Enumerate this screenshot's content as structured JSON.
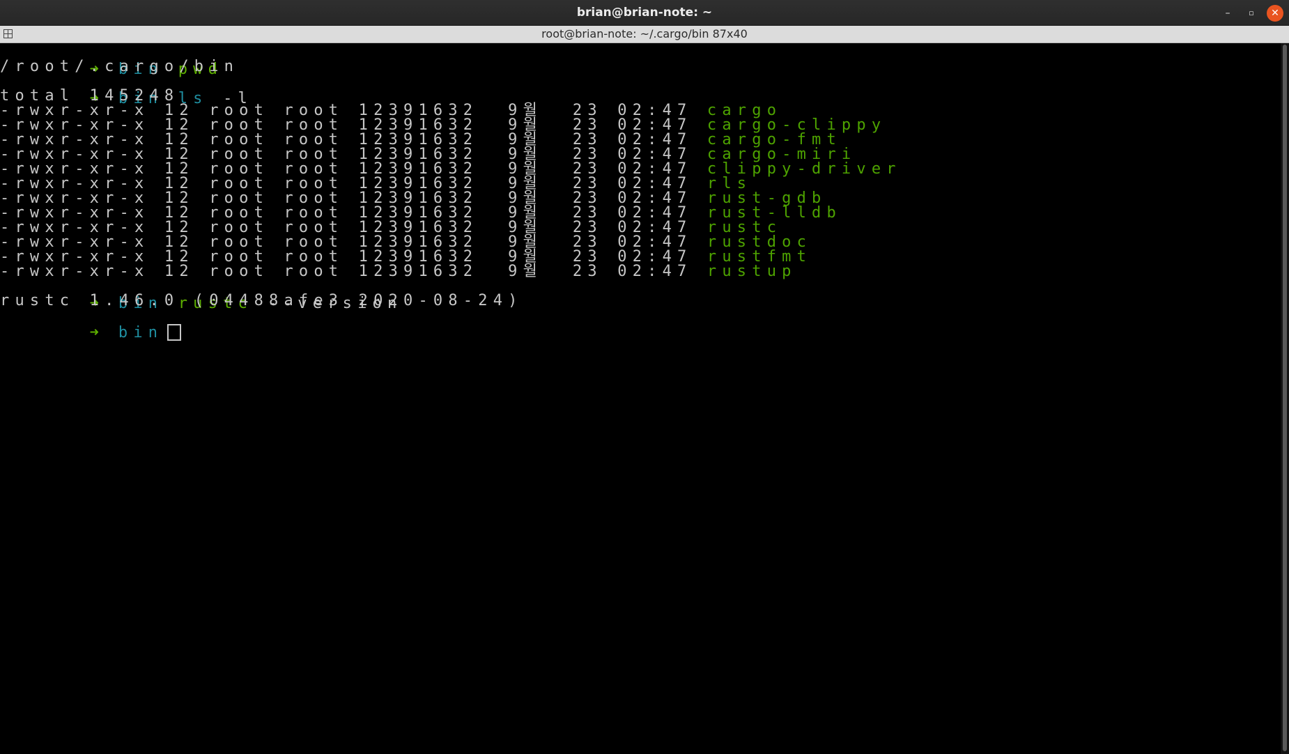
{
  "window": {
    "title": "brian@brian-note: ~",
    "tab_title": "root@brian-note: ~/.cargo/bin 87x40",
    "minimize_label": "–",
    "maximize_label": "▫",
    "close_label": "✕"
  },
  "colors": {
    "background": "#000000",
    "prompt_arrow": "#5eb000",
    "prompt_dir": "#1f8ea0",
    "executable": "#4ea300",
    "text": "#c7c7c7"
  },
  "terminal": {
    "prompt_arrow": "➜",
    "prompt_dir": "bin",
    "cmd1": {
      "command": "pwd",
      "args": ""
    },
    "out1": "/root/.cargo/bin",
    "cmd2": {
      "command": "ls",
      "args": "-l"
    },
    "total": "total 145248",
    "files": [
      {
        "perms": "-rwxr-xr-x 12 root root 12391632  9월  23 02:47 ",
        "name": "cargo"
      },
      {
        "perms": "-rwxr-xr-x 12 root root 12391632  9월  23 02:47 ",
        "name": "cargo-clippy"
      },
      {
        "perms": "-rwxr-xr-x 12 root root 12391632  9월  23 02:47 ",
        "name": "cargo-fmt"
      },
      {
        "perms": "-rwxr-xr-x 12 root root 12391632  9월  23 02:47 ",
        "name": "cargo-miri"
      },
      {
        "perms": "-rwxr-xr-x 12 root root 12391632  9월  23 02:47 ",
        "name": "clippy-driver"
      },
      {
        "perms": "-rwxr-xr-x 12 root root 12391632  9월  23 02:47 ",
        "name": "rls"
      },
      {
        "perms": "-rwxr-xr-x 12 root root 12391632  9월  23 02:47 ",
        "name": "rust-gdb"
      },
      {
        "perms": "-rwxr-xr-x 12 root root 12391632  9월  23 02:47 ",
        "name": "rust-lldb"
      },
      {
        "perms": "-rwxr-xr-x 12 root root 12391632  9월  23 02:47 ",
        "name": "rustc"
      },
      {
        "perms": "-rwxr-xr-x 12 root root 12391632  9월  23 02:47 ",
        "name": "rustdoc"
      },
      {
        "perms": "-rwxr-xr-x 12 root root 12391632  9월  23 02:47 ",
        "name": "rustfmt"
      },
      {
        "perms": "-rwxr-xr-x 12 root root 12391632  9월  23 02:47 ",
        "name": "rustup"
      }
    ],
    "cmd3": {
      "command": "rustc",
      "args": "--version"
    },
    "out3": "rustc 1.46.0 (04488afe3 2020-08-24)"
  }
}
